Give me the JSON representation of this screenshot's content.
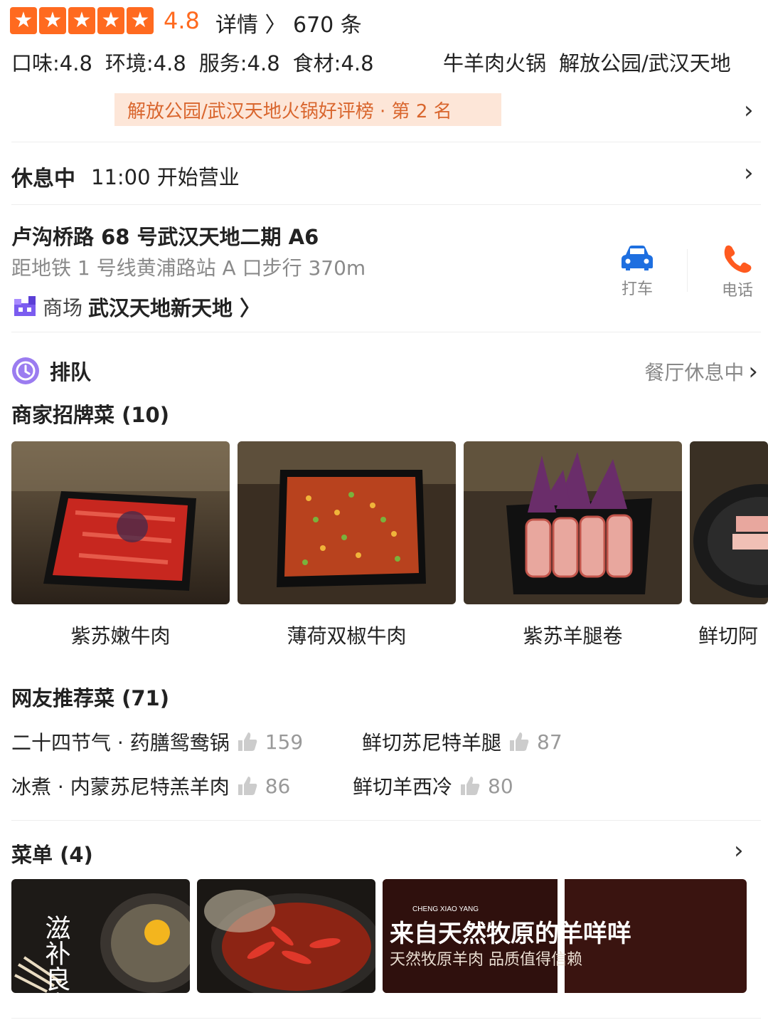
{
  "rating": {
    "score": "4.8",
    "stars": 5,
    "details_label": "详情 〉",
    "review_count": "670 条",
    "subscores": [
      "口味:4.8",
      "环境:4.8",
      "服务:4.8",
      "食材:4.8"
    ]
  },
  "cuisine": "牛羊肉火锅",
  "area": "解放公园/武汉天地",
  "ranking": "解放公园/武汉天地火锅好评榜 · 第 2 名",
  "hours": {
    "status": "休息中",
    "open_time": "11:00 开始营业"
  },
  "address": {
    "street": "卢沟桥路 68 号武汉天地二期 A6",
    "subway": "距地铁 1 号线黄浦路站 A 口步行 370m",
    "mall_label": "商场",
    "mall_name": "武汉天地新天地 〉"
  },
  "actions": {
    "taxi": "打车",
    "phone": "电话"
  },
  "queue": {
    "title": "排队",
    "status": "餐厅休息中"
  },
  "signature": {
    "title": "商家招牌菜 (10)",
    "dishes": [
      "紫苏嫩牛肉",
      "薄荷双椒牛肉",
      "紫苏羊腿卷",
      "鲜切阿"
    ]
  },
  "recommended": {
    "title": "网友推荐菜 (71)",
    "items": [
      {
        "name": "二十四节气 · 药膳鸳鸯锅",
        "likes": "159"
      },
      {
        "name": "鲜切苏尼特羊腿",
        "likes": "87"
      },
      {
        "name": "冰煮 · 内蒙苏尼特羔羊肉",
        "likes": "86"
      },
      {
        "name": "鲜切羊西冷",
        "likes": "80"
      }
    ]
  },
  "menu": {
    "title": "菜单 (4)",
    "card1_text": "滋补良方",
    "card3_brand": "CHENG XIAO YANG",
    "card3_line1": "来自天然牧原的羊咩咩",
    "card3_line2": "天然牧原羊肉 品质值得信赖"
  },
  "colors": {
    "accent": "#ff6a1f",
    "ranking_bg": "#fde6d8",
    "ranking_text": "#d9662e",
    "taxi": "#1e6fe0",
    "phone": "#ff5a1f",
    "queue": "#9b7cf0"
  }
}
